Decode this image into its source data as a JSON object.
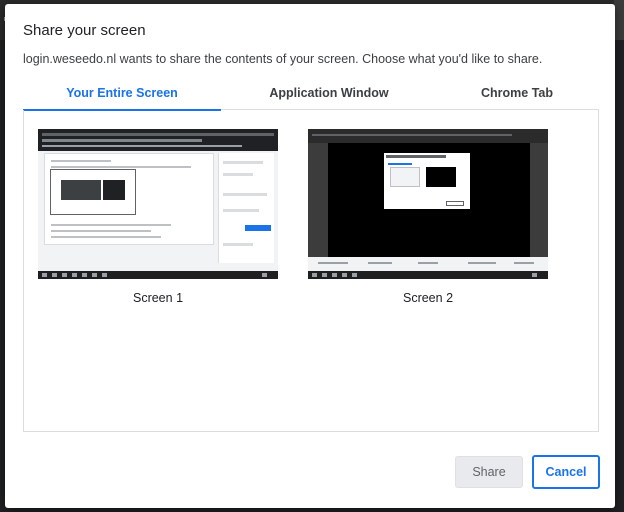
{
  "dialog": {
    "title": "Share your screen",
    "subtitle": "login.weseedo.nl wants to share the contents of your screen. Choose what you'd like to share."
  },
  "tabs": [
    {
      "label": "Your Entire Screen",
      "active": true
    },
    {
      "label": "Application Window",
      "active": false
    },
    {
      "label": "Chrome Tab",
      "active": false
    }
  ],
  "screens": [
    {
      "label": "Screen 1"
    },
    {
      "label": "Screen 2"
    }
  ],
  "buttons": {
    "share": "Share",
    "cancel": "Cancel"
  },
  "colors": {
    "accent": "#1a73e8",
    "disabled_bg": "#e8eaed"
  }
}
